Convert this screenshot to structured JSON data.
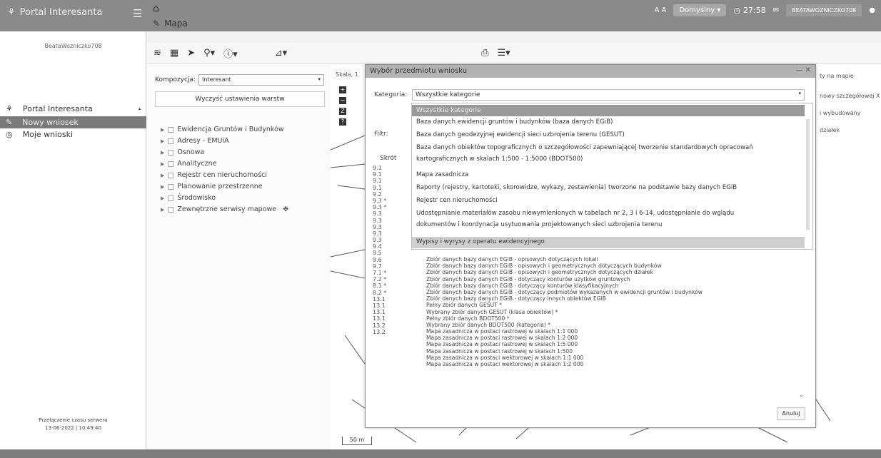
{
  "app": {
    "title": "Portal Interesanta",
    "breadcrumb": "Mapa"
  },
  "topbar": {
    "theme": "Domyślny",
    "time": "27:58",
    "user": "BEATAWOZNICZKO708"
  },
  "sidebar": {
    "username": "BeataWozniczko708",
    "items": [
      {
        "label": "Portal Interesanta"
      },
      {
        "label": "Nowy wniosek"
      },
      {
        "label": "Moje wnioski"
      }
    ],
    "footer_line1": "Przełączenie czasu serwera",
    "footer_line2": "13-06-2022 | 10:49:40"
  },
  "layer_panel": {
    "kompozycja_label": "Kompozycja:",
    "kompozycja_value": "Interesant",
    "clear_button": "Wyczyść ustawienia warstw",
    "layers": [
      "Ewidencja Gruntów i Budynków",
      "Adresy - EMUiA",
      "Osnowa",
      "Analityczne",
      "Rejestr cen nieruchomości",
      "Planowanie przestrzenne",
      "Środowisko",
      "Zewnętrzne serwisy mapowe"
    ]
  },
  "map": {
    "skala_label": "Skala, 1",
    "scalebar": "50 m",
    "right_texts": [
      "ty na mapie",
      "nowy szczegółowej X",
      "i wybudowany",
      "działek"
    ]
  },
  "dialog": {
    "title": "Wybór przedmiotu wniosku",
    "kategoria_label": "Kategoria:",
    "kategoria_value": "Wszystkie kategorie",
    "filtr_label": "Filtr:",
    "skrot_label": "Skrót",
    "codes": [
      "9.1",
      "9.1",
      "9.1",
      "9.1",
      "9.2",
      "9.3 *",
      "9.3 *",
      "9.3",
      "9.3",
      "9.3",
      "9.3",
      "9.3",
      "9.4",
      "9.5",
      "9.6",
      "9.7",
      "7.1 *",
      "7.2 *",
      "8.1 *",
      "8.2 *",
      "13.1",
      "13.1",
      "13.1",
      "13.1",
      "13.2",
      "13.2"
    ],
    "rows": [
      "Zbiór danych bazy danych EGiB - opisowych dotyczących lokali",
      "Zbiór danych bazy danych EGiB - opisowych i geometrycznych dotyczących budynków",
      "Zbiór danych bazy danych EGiB - opisowych i geometrycznych dotyczących działek",
      "Zbiór danych bazy danych EGiB - dotyczący konturów użytków gruntowych",
      "Zbiór danych bazy danych EGiB - dotyczący konturów klasyfikacyjnych",
      "Zbiór danych bazy danych EGiB - dotyczący podmiotów wykazanych w ewidencji gruntów i budynków",
      "Zbiór danych bazy danych EGiB - dotyczący innych obiektów EGiB",
      "Pełny zbiór danych GESUT *",
      "Wybrany zbiór danych GESUT (klasa obiektów) *",
      "Pełny zbiór danych BDOT500 *",
      "Wybrany zbiór danych BDOT500 (kategoria) *",
      "Mapa zasadnicza w postaci rastrowej w skalach 1:1 000",
      "Mapa zasadnicza w postaci rastrowej w skalach 1:2 000",
      "Mapa zasadnicza w postaci rastrowej w skalach 1:5 000",
      "Mapa zasadnicza w postaci rastrowej w skalach 1:500",
      "Mapa zasadnicza w postaci wektorowej w skalach 1:1 000",
      "Mapa zasadnicza w postaci wektorowej w skalach 1:2 000"
    ],
    "cancel": "Anuluj",
    "dropdown": {
      "selected": "Wszystkie kategorie",
      "items": [
        "Baza danych ewidencji gruntów i budynków (baza danych EGiB)",
        "Baza danych geodezyjnej ewidencji sieci uzbrojenia terenu (GESUT)",
        "Baza danych obiektów topograficznych o szczegółowości zapewniającej tworzenie standardowych opracowań",
        "kartograficznych w skalach 1:500 - 1:5000 (BDOT500)",
        "Mapa zasadnicza",
        "Raporty (rejestry, kartoteki, skorowidze, wykazy, zestawienia) tworzone na podstawie bazy danych EGiB",
        "Rejestr cen nieruchomości",
        "Udostępnianie materiałów zasobu niewymienionych w tabelach nr 2, 3 i 6-14, udostępnianie do wglądu",
        "dokumentów i koordynacja usytuowania projektowanych sieci uzbrojenia terenu"
      ],
      "group": "Wypisy i wyrysy z operatu ewidencyjnego"
    }
  }
}
